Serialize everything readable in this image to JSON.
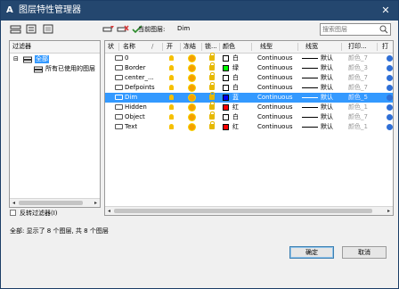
{
  "window": {
    "title": "图层特性管理器",
    "close_glyph": "✕",
    "app_glyph": "A"
  },
  "toolbar": {
    "current_layer_label": "当前图层:",
    "current_layer_value": "Dim",
    "search_placeholder": "搜索图层",
    "icons": [
      "new-property-filter-icon",
      "new-group-filter-icon",
      "layer-states-manager-icon",
      "new-layer-icon",
      "delete-layer-icon",
      "set-current-icon"
    ]
  },
  "filter_tree": {
    "header": "过滤器",
    "root": {
      "expander": "⊟",
      "label": "全部"
    },
    "child": {
      "label": "所有已使用的图层"
    },
    "scroll_left": "◂",
    "scroll_right": "▸"
  },
  "invert_filter": {
    "label": "反转过滤器(I)",
    "checked": false
  },
  "grid": {
    "headers": [
      "状",
      "名称",
      "/",
      "开",
      "冻结",
      "锁...",
      "颜色",
      "线型",
      "线宽",
      "打印...",
      "打"
    ],
    "rows": [
      {
        "name": "0",
        "color_name": "白",
        "color": "#ffffff",
        "linetype": "Continuous",
        "lineweight": "默认",
        "plot_style": "颜色_7",
        "selected": false
      },
      {
        "name": "Border",
        "color_name": "绿",
        "color": "#00ff00",
        "linetype": "Continuous",
        "lineweight": "默认",
        "plot_style": "颜色_3",
        "selected": false
      },
      {
        "name": "center_...",
        "color_name": "白",
        "color": "#ffffff",
        "linetype": "Continuous",
        "lineweight": "默认",
        "plot_style": "颜色_7",
        "selected": false
      },
      {
        "name": "Defpoints",
        "color_name": "白",
        "color": "#ffffff",
        "linetype": "Continuous",
        "lineweight": "默认",
        "plot_style": "颜色_7",
        "selected": false
      },
      {
        "name": "Dim",
        "color_name": "蓝",
        "color": "#0000ff",
        "linetype": "Continuous",
        "lineweight": "默认",
        "plot_style": "颜色_5",
        "selected": true
      },
      {
        "name": "Hidden",
        "color_name": "红",
        "color": "#ff0000",
        "linetype": "Continuous",
        "lineweight": "默认",
        "plot_style": "颜色_1",
        "selected": false
      },
      {
        "name": "Object",
        "color_name": "白",
        "color": "#ffffff",
        "linetype": "Continuous",
        "lineweight": "默认",
        "plot_style": "颜色_7",
        "selected": false
      },
      {
        "name": "Text",
        "color_name": "红",
        "color": "#ff0000",
        "linetype": "Continuous",
        "lineweight": "默认",
        "plot_style": "颜色_1",
        "selected": false
      }
    ],
    "scroll_left": "◂",
    "scroll_right": "▸"
  },
  "status": "全部: 显示了 8 个图层, 共 8 个图层",
  "buttons": {
    "ok": "确定",
    "cancel": "取消"
  },
  "colors": {
    "title_bar": "#24476f",
    "selection": "#3399ff",
    "bulb": "#f6c000",
    "sun": "#f5a100",
    "plot_icon": "#2f6fd6"
  }
}
